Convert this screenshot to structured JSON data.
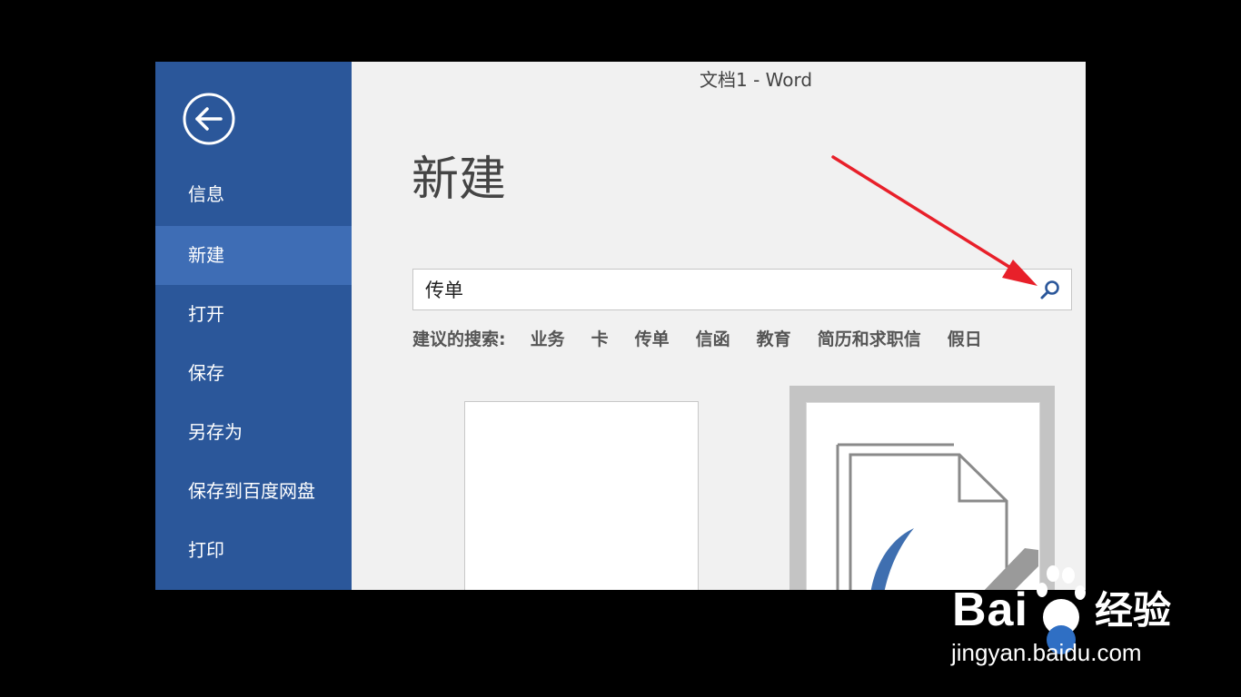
{
  "window": {
    "title": "文档1 - Word"
  },
  "sidebar": {
    "items": [
      {
        "label": "信息"
      },
      {
        "label": "新建"
      },
      {
        "label": "打开"
      },
      {
        "label": "保存"
      },
      {
        "label": "另存为"
      },
      {
        "label": "保存到百度网盘"
      },
      {
        "label": "打印"
      }
    ],
    "active_index": 1
  },
  "main": {
    "heading": "新建",
    "search": {
      "value": "传单"
    },
    "suggested": {
      "label": "建议的搜索:",
      "items": [
        "业务",
        "卡",
        "传单",
        "信函",
        "教育",
        "简历和求职信",
        "假日"
      ]
    }
  },
  "watermark": {
    "brand": "Bai",
    "brand_tail": "经验",
    "url": "jingyan.baidu.com"
  },
  "colors": {
    "sidebar": "#2b579a",
    "sidebar_active": "#3e6db5",
    "annotation_arrow": "#e8202a"
  }
}
